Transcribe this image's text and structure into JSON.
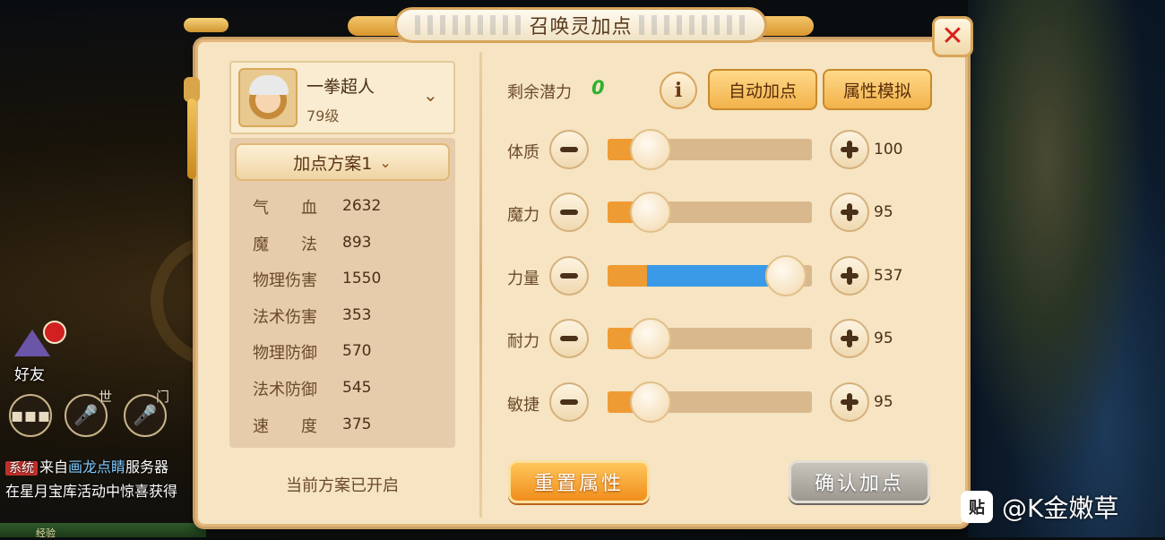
{
  "title": "召唤灵加点",
  "pet": {
    "name": "一拳超人",
    "level": "79级"
  },
  "plan": {
    "label": "加点方案1",
    "status": "当前方案已开启"
  },
  "stats": [
    {
      "label": "气　　血",
      "value": "2632"
    },
    {
      "label": "魔　　法",
      "value": "893"
    },
    {
      "label": "物理伤害",
      "value": "1550"
    },
    {
      "label": "法术伤害",
      "value": "353"
    },
    {
      "label": "物理防御",
      "value": "570"
    },
    {
      "label": "法术防御",
      "value": "545"
    },
    {
      "label": "速　　度",
      "value": "375"
    }
  ],
  "potential": {
    "label": "剩余潜力",
    "value": "0"
  },
  "buttons": {
    "auto_allocate": "自动加点",
    "simulate": "属性模拟",
    "reset": "重置属性",
    "confirm": "确认加点",
    "info": "i"
  },
  "attributes": [
    {
      "label": "体质",
      "value": "100",
      "base_fraction": 0.0,
      "alloc_fraction": 0.0
    },
    {
      "label": "魔力",
      "value": "95",
      "base_fraction": 0.0,
      "alloc_fraction": 0.0
    },
    {
      "label": "力量",
      "value": "537",
      "base_fraction": 0.0,
      "alloc_fraction": 0.82
    },
    {
      "label": "耐力",
      "value": "95",
      "base_fraction": 0.0,
      "alloc_fraction": 0.0
    },
    {
      "label": "敏捷",
      "value": "95",
      "base_fraction": 0.0,
      "alloc_fraction": 0.0
    }
  ],
  "hud": {
    "friend_label": "好友",
    "world_tag": "世",
    "clan_tag": "门",
    "chat_tag": "系统",
    "chat_line1_prefix": "来自",
    "chat_line1_link": "画龙点睛",
    "chat_line1_suffix": "服务器",
    "chat_line2": "在星月宝库活动中惊喜获得",
    "exp_label": "经验"
  },
  "watermark": {
    "icon": "贴",
    "text": "@K金嫩草"
  },
  "colors": {
    "accent_gold": "#f2b24a",
    "potential_green": "#2fb02f",
    "close_red": "#d8201a",
    "slider_blue": "#3a9ae8",
    "slider_orange": "#ef9b33"
  }
}
